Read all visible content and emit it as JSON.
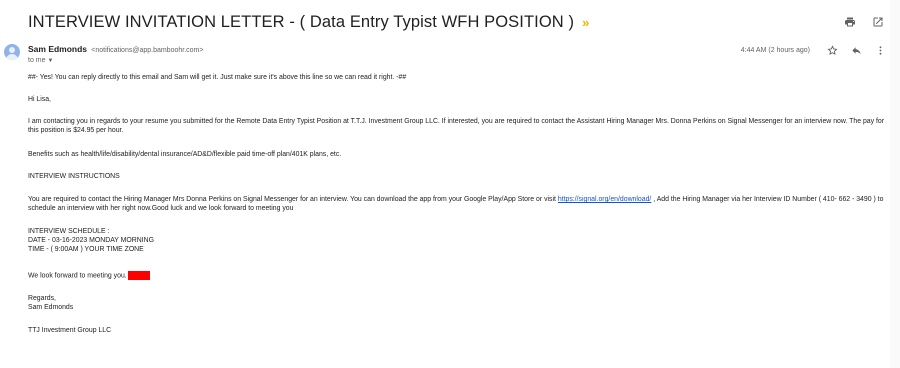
{
  "header": {
    "subject": "INTERVIEW INVITATION LETTER - ( Data Entry Typist WFH POSITION )",
    "importance_glyph": "»",
    "print_icon": "print-icon",
    "open_new_icon": "open-in-new-window-icon"
  },
  "sender": {
    "name": "Sam Edmonds",
    "email": "<notifications@app.bamboohr.com>",
    "to_label": "to me",
    "timestamp": "4:44 AM (2 hours ago)"
  },
  "body": {
    "reply_note": "##- Yes! You can reply directly to this email and Sam will get it. Just make sure it's above this line so we can read it right. -##",
    "greeting": "Hi Lisa,",
    "para1": "I am contacting you in regards to your resume you submitted for the Remote Data Entry Typist Position at T.T.J. Investment Group LLC. If interested, you are required to contact the Assistant Hiring Manager Mrs. Donna Perkins on Signal Messenger for an interview now. The pay for this position is $24.95 per hour.",
    "para2": "Benefits such as health/life/disability/dental insurance/AD&D/flexible paid time-off plan/401K plans, etc.",
    "instructions_heading": "INTERVIEW INSTRUCTIONS",
    "para3_before_link": "You are required to contact the Hiring Manager Mrs Donna Perkins on Signal Messenger for an interview. You can download the app from your Google Play/App Store or visit ",
    "para3_link": "https://signal.org/en/download/",
    "para3_after_link": " , Add the Hiring Manager via her Interview ID Number ( 410- 662 - 3490 ) to schedule an interview with her right now.Good luck and we look forward to meeting you",
    "schedule_heading": "INTERVIEW SCHEDULE :",
    "schedule_date": "DATE - 03-16-2023 MONDAY MORNING",
    "schedule_time": "TIME - ( 9:00AM ) YOUR TIME ZONE",
    "closing_line": "We look forward to meeting you.",
    "signoff": "Regards,",
    "signoff_name": "Sam Edmonds",
    "company": "TTJ Investment Group LLC"
  }
}
